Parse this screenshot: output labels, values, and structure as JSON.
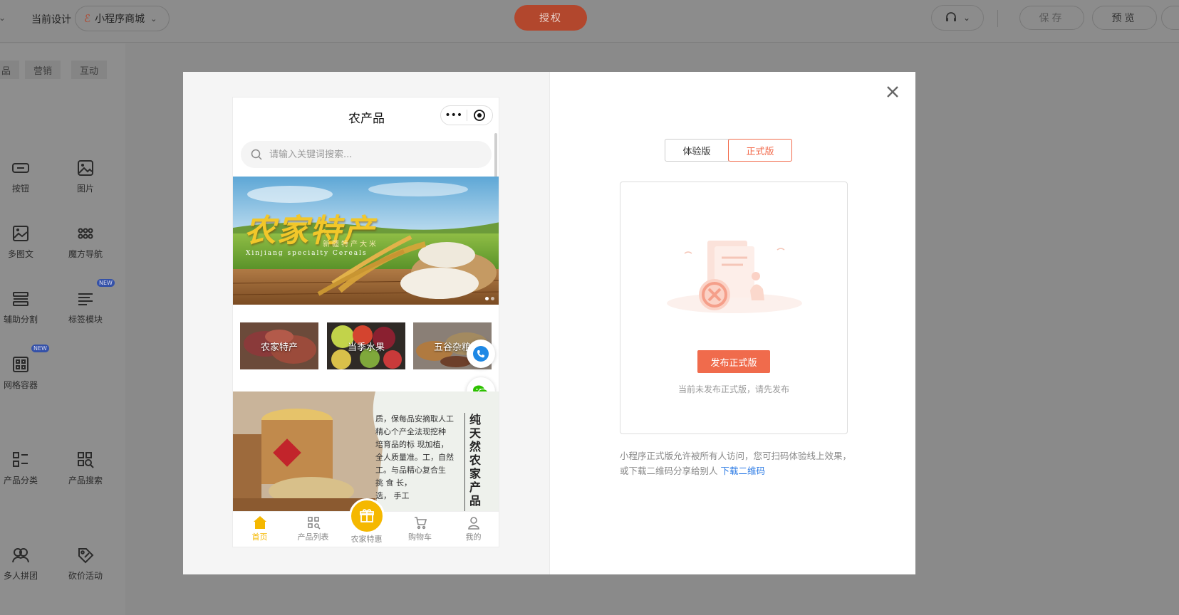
{
  "topbar": {
    "current_design_label": "当前设计",
    "app_select_value": "小程序商城",
    "auth_label": "授权",
    "save_label": "保存",
    "preview_label": "预览"
  },
  "left_panel": {
    "tabs": [
      "品",
      "营销",
      "互动"
    ],
    "items": [
      {
        "label": "按钮",
        "icon": "button-icon"
      },
      {
        "label": "图片",
        "icon": "image-icon"
      },
      {
        "label": "多图文",
        "icon": "multi-image-text-icon"
      },
      {
        "label": "魔方导航",
        "icon": "cube-nav-icon"
      },
      {
        "label": "辅助分割",
        "icon": "divider-icon"
      },
      {
        "label": "标签模块",
        "icon": "tag-module-icon",
        "badge": "NEW"
      },
      {
        "label": "网格容器",
        "icon": "grid-container-icon",
        "badge": "NEW"
      },
      {
        "label": "产品分类",
        "icon": "product-category-icon"
      },
      {
        "label": "产品搜索",
        "icon": "product-search-icon"
      },
      {
        "label": "多人拼团",
        "icon": "group-buy-icon"
      },
      {
        "label": "砍价活动",
        "icon": "bargain-icon"
      }
    ]
  },
  "phone": {
    "title": "农产品",
    "capsule_more": "•••",
    "search_placeholder": "请输入关键词搜索...",
    "banner": {
      "title": "农家特产",
      "subtitle": "新疆特产大米",
      "english": "Xinjiang specialty Cereals"
    },
    "categories": [
      "农家特产",
      "当季水果",
      "五谷杂粮"
    ],
    "article": {
      "text_lines": [
        "质，保每品安摘取人工",
        "精心个产全法现挖种",
        "培育品的标   现加植，",
        "全人质量准。工，自然",
        "工。与品精心复合生",
        "         挑   食   长，",
        "         选，       手工"
      ],
      "vertical_title": "纯天然农家产品"
    },
    "tabbar": [
      {
        "label": "首页",
        "icon": "home-icon",
        "active": true
      },
      {
        "label": "产品列表",
        "icon": "product-list-icon"
      },
      {
        "label": "农家特惠",
        "icon": "gift-icon"
      },
      {
        "label": "购物车",
        "icon": "cart-icon"
      },
      {
        "label": "我的",
        "icon": "user-icon"
      }
    ]
  },
  "right": {
    "toggle": [
      "体验版",
      "正式版"
    ],
    "publish_label": "发布正式版",
    "not_published": "当前未发布正式版，请先发布",
    "desc_text": "小程序正式版允许被所有人访问，您可扫码体验线上效果，或下载二维码分享给别人",
    "download_link": "下载二维码"
  },
  "colors": {
    "accent": "#f06b4c",
    "tab_active": "#f5b800",
    "link": "#2c7be5"
  }
}
